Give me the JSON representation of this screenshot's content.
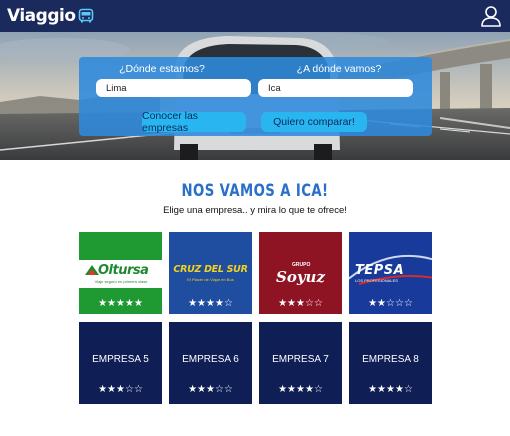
{
  "brand": {
    "name": "Viaggio",
    "bus_icon": "bus-icon",
    "user_icon": "user-icon"
  },
  "colors": {
    "topbar": "#1b2a5c",
    "accent": "#2a6fc9",
    "panel": "#2e8adc",
    "button": "#29b6f0",
    "card_dark": "#0f1e55"
  },
  "search": {
    "origin_label": "¿Dónde estamos?",
    "origin_value": "Lima",
    "destination_label": "¿A dónde vamos?",
    "destination_value": "Ica",
    "browse_button": "Conocer las empresas",
    "compare_button": "Quiero comparar!"
  },
  "heading": {
    "title": "NOS VAMOS A ICA!",
    "subtitle": "Elige una empresa.. y mira lo que te ofrece!"
  },
  "companies": [
    {
      "name": "Oltursa",
      "tagline": "Viaje seguro en primera clase",
      "rating": 5,
      "color": "#1f9a33"
    },
    {
      "name": "CRUZ DEL SUR",
      "tagline": "El Placer de Viajar en Bus",
      "rating": 4,
      "color": "#1f4da0"
    },
    {
      "name": "Soyuz",
      "prefix": "GRUPO",
      "rating": 3,
      "color": "#8e1424"
    },
    {
      "name": "TEPSA",
      "tagline": "LOS PROFESIONALES",
      "rating": 2,
      "color": "#183a9a"
    },
    {
      "name": "EMPRESA 5",
      "rating": 3,
      "color": "#0f1e55"
    },
    {
      "name": "EMPRESA 6",
      "rating": 3,
      "color": "#0f1e55"
    },
    {
      "name": "EMPRESA 7",
      "rating": 4,
      "color": "#0f1e55"
    },
    {
      "name": "EMPRESA 8",
      "rating": 4,
      "color": "#0f1e55"
    }
  ]
}
